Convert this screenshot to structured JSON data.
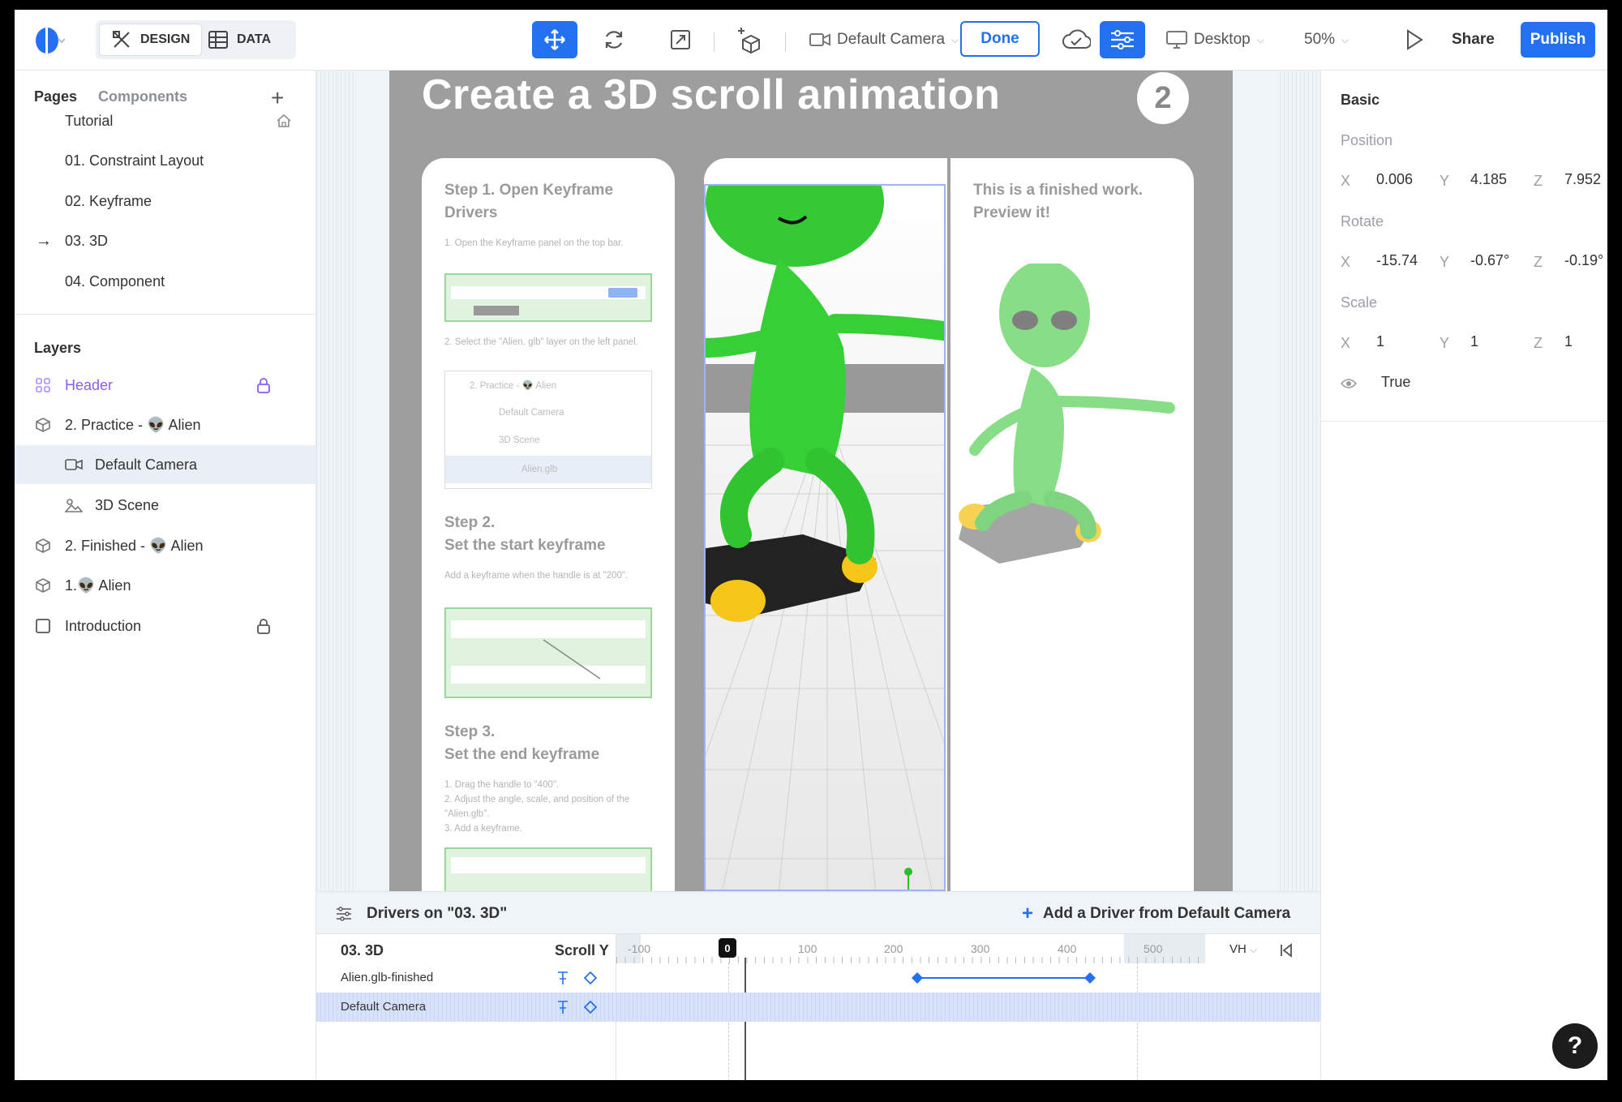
{
  "toolbar": {
    "design_label": "DESIGN",
    "data_label": "DATA",
    "camera_label": "Default Camera",
    "done_label": "Done",
    "device_label": "Desktop",
    "zoom_label": "50%",
    "share_label": "Share",
    "publish_label": "Publish"
  },
  "left": {
    "tab_pages": "Pages",
    "tab_components": "Components",
    "pages": [
      {
        "label": "Tutorial"
      },
      {
        "label": "01. Constraint Layout"
      },
      {
        "label": "02. Keyframe"
      },
      {
        "label": "03. 3D"
      },
      {
        "label": "04. Component"
      }
    ],
    "layers_title": "Layers",
    "layers": [
      {
        "label": "Header"
      },
      {
        "label": "2. Practice - 👽 Alien"
      },
      {
        "label": "Default Camera"
      },
      {
        "label": "3D Scene"
      },
      {
        "label": "2. Finished - 👽 Alien"
      },
      {
        "label": "1.👽 Alien"
      },
      {
        "label": "Introduction"
      }
    ]
  },
  "canvas": {
    "title": "Create a 3D scroll animation",
    "badge": "2",
    "step1_title": "Step 1. Open Keyframe Drivers",
    "step1_text1": "1. Open the Keyframe panel on the top bar.",
    "step1_text2": "2. Select the \"Alien. glb\" layer on the left panel.",
    "tree": [
      "2. Practice - 👽 Alien",
      "Default Camera",
      "3D Scene",
      "Alien.glb"
    ],
    "step2_title": "Step 2.\nSet the start keyframe",
    "step2_text": "Add a keyframe when the handle is at \"200\".",
    "step3_title": "Step 3.\nSet the end keyframe",
    "step3_text": "1. Drag the handle to \"400\".\n2. Adjust the angle, scale, and position of the \"Alien.glb\".\n3. Add a keyframe.",
    "preview_text": "This is a finished work. Preview it!"
  },
  "drivers": {
    "title": "Drivers on \"03. 3D\"",
    "add_label": "Add a Driver from Default Camera",
    "page_label": "03. 3D",
    "axis_label": "Scroll Y",
    "unit": "VH",
    "playhead": "0",
    "ticks": [
      "-100",
      "100",
      "200",
      "300",
      "400",
      "500"
    ],
    "rows": [
      {
        "label": "Alien.glb-finished",
        "keyframes": [
          200,
          400
        ]
      },
      {
        "label": "Default Camera",
        "keyframes": []
      }
    ]
  },
  "right": {
    "title": "Basic",
    "position_label": "Position",
    "position": {
      "x": "0.006",
      "y": "4.185",
      "z": "7.952"
    },
    "rotate_label": "Rotate",
    "rotate": {
      "x": "-15.74",
      "y": "-0.67°",
      "z": "-0.19°"
    },
    "scale_label": "Scale",
    "scale": {
      "x": "1",
      "y": "1",
      "z": "1"
    },
    "visible_value": "True",
    "axis_x": "X",
    "axis_y": "Y",
    "axis_z": "Z"
  },
  "help_label": "?",
  "colors": {
    "accent": "#2371f0",
    "header_layer": "#8b5cf6",
    "frame": "#9e9e9e",
    "alien": "#3bd33b"
  }
}
